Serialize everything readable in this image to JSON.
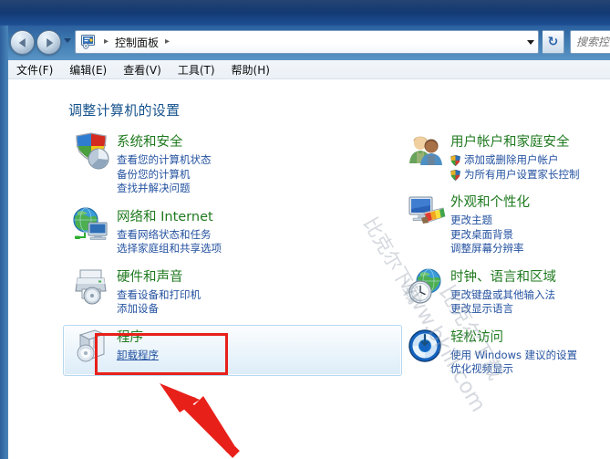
{
  "window": {
    "nav": {
      "back_label": "后退",
      "forward_label": "前进",
      "recent_pages_label": "最近浏览的页面",
      "refresh_label": "刷新",
      "refresh_glyph": "↻",
      "dropdown_label": "地址栏下拉"
    },
    "address": {
      "icon_name": "control-panel-icon",
      "crumbs": [
        "控制面板"
      ],
      "sep": "▸"
    },
    "search": {
      "value": "",
      "placeholder": "搜索控"
    }
  },
  "menubar": {
    "items": [
      {
        "label": "文件(F)",
        "name": "menu-file"
      },
      {
        "label": "编辑(E)",
        "name": "menu-edit"
      },
      {
        "label": "查看(V)",
        "name": "menu-view"
      },
      {
        "label": "工具(T)",
        "name": "menu-tools"
      },
      {
        "label": "帮助(H)",
        "name": "menu-help"
      }
    ]
  },
  "page": {
    "title": "调整计算机的设置"
  },
  "categories": {
    "left": [
      {
        "name": "system-and-security",
        "title": "系统和安全",
        "icon": "shield-icon",
        "hovered": false,
        "links": [
          {
            "label": "查看您的计算机状态",
            "shield": false
          },
          {
            "label": "备份您的计算机",
            "shield": false
          },
          {
            "label": "查找并解决问题",
            "shield": false
          }
        ]
      },
      {
        "name": "network-and-internet",
        "title": "网络和 Internet",
        "icon": "globe-network-icon",
        "hovered": false,
        "links": [
          {
            "label": "查看网络状态和任务",
            "shield": false
          },
          {
            "label": "选择家庭组和共享选项",
            "shield": false
          }
        ]
      },
      {
        "name": "hardware-and-sound",
        "title": "硬件和声音",
        "icon": "printer-icon",
        "hovered": false,
        "links": [
          {
            "label": "查看设备和打印机",
            "shield": false
          },
          {
            "label": "添加设备",
            "shield": false
          }
        ]
      },
      {
        "name": "programs",
        "title": "程序",
        "icon": "programs-box-icon",
        "hovered": true,
        "links": [
          {
            "label": "卸载程序",
            "shield": false
          }
        ]
      }
    ],
    "right": [
      {
        "name": "user-accounts-and-family-safety",
        "title": "用户帐户和家庭安全",
        "icon": "users-icon",
        "hovered": false,
        "links": [
          {
            "label": "添加或删除用户帐户",
            "shield": true
          },
          {
            "label": "为所有用户设置家长控制",
            "shield": true
          }
        ]
      },
      {
        "name": "appearance-and-personalization",
        "title": "外观和个性化",
        "icon": "monitor-palette-icon",
        "hovered": false,
        "links": [
          {
            "label": "更改主题",
            "shield": false
          },
          {
            "label": "更改桌面背景",
            "shield": false
          },
          {
            "label": "调整屏幕分辨率",
            "shield": false
          }
        ]
      },
      {
        "name": "clock-language-and-region",
        "title": "时钟、语言和区域",
        "icon": "globe-clock-icon",
        "hovered": false,
        "links": [
          {
            "label": "更改键盘或其他输入法",
            "shield": false
          },
          {
            "label": "更改显示语言",
            "shield": false
          }
        ]
      },
      {
        "name": "ease-of-access",
        "title": "轻松访问",
        "icon": "ease-of-access-icon",
        "hovered": false,
        "links": [
          {
            "label": "使用 Windows 建议的设置",
            "shield": false
          },
          {
            "label": "优化视频显示",
            "shield": false
          }
        ]
      }
    ]
  },
  "annotation": {
    "box_color": "#e8201a",
    "arrow_color": "#e8201a",
    "target": "programs"
  },
  "watermark": {
    "line1": "www.bkill.com",
    "line2": "比克尔下载",
    "line3": "比克尔下载",
    "color": "#96a0af"
  },
  "colors": {
    "category_title": "#1f7a1f",
    "sublink": "#2452a0",
    "page_title": "#16538c",
    "frame": "#2a5fa4",
    "content_bg": "#ffffff"
  }
}
